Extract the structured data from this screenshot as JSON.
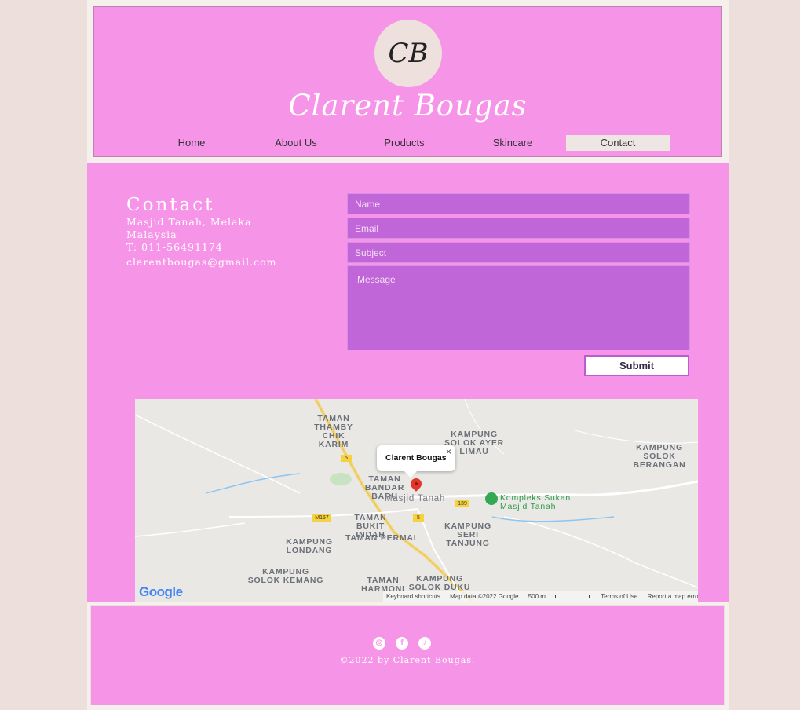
{
  "header": {
    "logo_text": "CB",
    "site_title": "Clarent Bougas",
    "nav": [
      {
        "label": "Home"
      },
      {
        "label": "About Us"
      },
      {
        "label": "Products"
      },
      {
        "label": "Skincare"
      },
      {
        "label": "Contact",
        "active": true
      }
    ]
  },
  "contact": {
    "title": "Contact",
    "address_line1": "Masjid Tanah, Melaka",
    "address_line2": "Malaysia",
    "phone": "T: 011-56491174",
    "email": "clarentbougas@gmail.com"
  },
  "form": {
    "name_placeholder": "Name",
    "email_placeholder": "Email",
    "subject_placeholder": "Subject",
    "message_placeholder": "Message",
    "submit_label": "Submit"
  },
  "map": {
    "popup_title": "Clarent Bougas",
    "close_symbol": "×",
    "labels": [
      "TAMAN THAMBY CHIK KARIM",
      "KAMPUNG SOLOK AYER LIMAU",
      "KAMPUNG SOLOK BERANGAN",
      "TAMAN BANDAR BARU",
      "Masjid Tanah",
      "Kompleks Sukan Masjid Tanah",
      "TAMAN BUKIT INDAH",
      "TAMAN PERMAI",
      "KAMPUNG SERI TANJUNG",
      "KAMPUNG LONDANG",
      "KAMPUNG SOLOK KEMANG",
      "TAMAN HARMONI",
      "KAMPUNG SOLOK DUKU"
    ],
    "road_badges": [
      "5",
      "5",
      "139",
      "M157"
    ],
    "google_logo": "Google",
    "attribution": [
      "Keyboard shortcuts",
      "Map data ©2022 Google",
      "500 m",
      "Terms of Use",
      "Report a map error"
    ]
  },
  "footer": {
    "social": [
      "instagram-icon",
      "facebook-icon",
      "tiktok-icon"
    ],
    "social_glyphs": [
      "◎",
      "f",
      "♪"
    ],
    "copyright": "©2022 by Clarent Bougas."
  },
  "colors": {
    "pink": "#f695e8",
    "purple_field": "#c166d8",
    "beige": "#ede0dc"
  }
}
